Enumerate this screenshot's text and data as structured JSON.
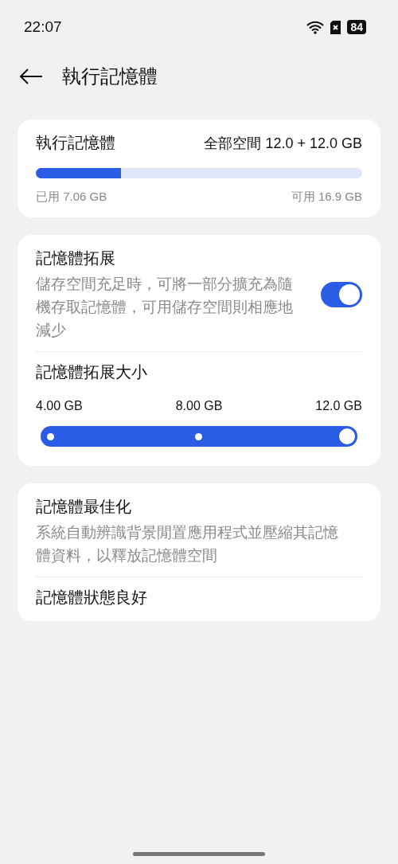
{
  "status_bar": {
    "time": "22:07",
    "battery": "84"
  },
  "header": {
    "title": "執行記憶體"
  },
  "ram_card": {
    "title": "執行記憶體",
    "total": "全部空間 12.0 + 12.0 GB",
    "usage": {
      "level": 0.26
    },
    "used": "已用 7.06 GB",
    "available": "可用 16.9 GB"
  },
  "expansion_card": {
    "title": "記憶體拓展",
    "description": "儲存空間充足時，可將一部分擴充為隨機存取記憶體，可用儲存空間則相應地減少",
    "on": true,
    "size_title": "記憶體拓展大小",
    "stops": [
      {
        "label": "4.00 GB"
      },
      {
        "label": "8.00 GB"
      },
      {
        "label": "12.0 GB"
      }
    ],
    "slider": {
      "level": 1
    }
  },
  "optimize_card": {
    "title": "記憶體最佳化",
    "description": "系統自動辨識背景閒置應用程式並壓縮其記憶體資料，以釋放記憶體空間",
    "status": "記憶體狀態良好"
  }
}
